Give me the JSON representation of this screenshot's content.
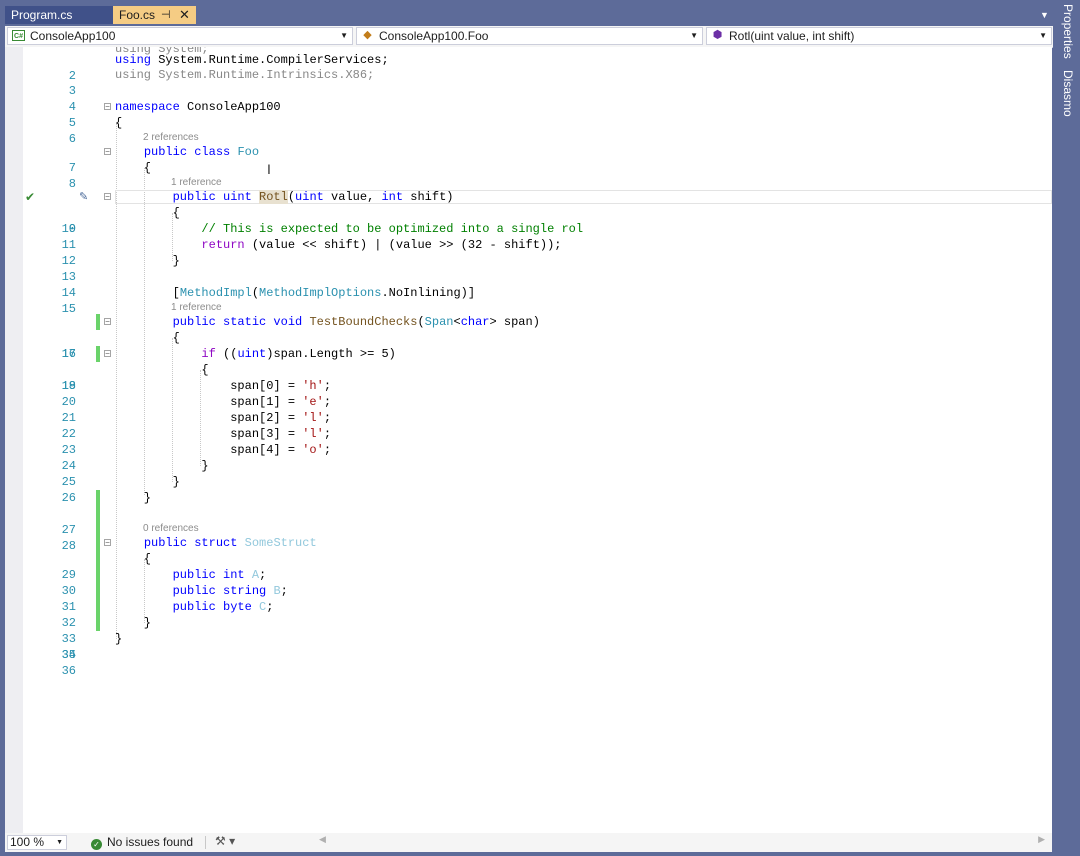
{
  "tabs": [
    {
      "label": "Program.cs",
      "active": false
    },
    {
      "label": "Foo.cs",
      "active": true,
      "pin_glyph": "⊣",
      "close_glyph": "✕"
    }
  ],
  "nav": {
    "project": {
      "icon": "csharp-project-icon",
      "label": "ConsoleApp100"
    },
    "type": {
      "icon": "class-icon",
      "label": "ConsoleApp100.Foo"
    },
    "member": {
      "icon": "method-icon",
      "label": "Rotl(uint value, int shift)"
    }
  },
  "editor": {
    "references": [
      "2 references",
      "1 reference",
      "1 reference",
      "0 references"
    ],
    "lines": [
      {
        "n": "2",
        "t": "using System.Runtime.CompilerServices;"
      },
      {
        "n": "3",
        "t": "using System.Runtime.Intrinsics.X86;"
      },
      {
        "n": "4",
        "t": ""
      },
      {
        "n": "5",
        "t": "namespace ConsoleApp100"
      },
      {
        "n": "6",
        "t": "{"
      },
      {
        "n": "7",
        "t": "    public class Foo"
      },
      {
        "n": "8",
        "t": "    {"
      },
      {
        "n": "9",
        "t": "        public uint Rotl(uint value, int shift)"
      },
      {
        "n": "10",
        "t": "        {"
      },
      {
        "n": "11",
        "t": "            // This is expected to be optimized into a single rol"
      },
      {
        "n": "12",
        "t": "            return (value << shift) | (value >> (32 - shift));"
      },
      {
        "n": "13",
        "t": "        }"
      },
      {
        "n": "14",
        "t": ""
      },
      {
        "n": "15",
        "t": "        [MethodImpl(MethodImplOptions.NoInlining)]"
      },
      {
        "n": "16",
        "t": "        public static void TestBoundChecks(Span<char> span)"
      },
      {
        "n": "17",
        "t": "        {"
      },
      {
        "n": "18",
        "t": "            if ((uint)span.Length >= 5)"
      },
      {
        "n": "19",
        "t": "            {"
      },
      {
        "n": "20",
        "t": "                span[0] = 'h';"
      },
      {
        "n": "21",
        "t": "                span[1] = 'e';"
      },
      {
        "n": "22",
        "t": "                span[2] = 'l';"
      },
      {
        "n": "23",
        "t": "                span[3] = 'l';"
      },
      {
        "n": "24",
        "t": "                span[4] = 'o';"
      },
      {
        "n": "25",
        "t": "            }"
      },
      {
        "n": "26",
        "t": "        }"
      },
      {
        "n": "27",
        "t": "    }"
      },
      {
        "n": "28",
        "t": ""
      },
      {
        "n": "29",
        "t": "    public struct SomeStruct"
      },
      {
        "n": "30",
        "t": "    {"
      },
      {
        "n": "31",
        "t": "        public int A;"
      },
      {
        "n": "32",
        "t": "        public string B;"
      },
      {
        "n": "33",
        "t": "        public byte C;"
      },
      {
        "n": "34",
        "t": "    }"
      },
      {
        "n": "35",
        "t": "}"
      },
      {
        "n": "36",
        "t": ""
      }
    ]
  },
  "status": {
    "zoom": "100 %",
    "issues": "No issues found",
    "issues_icon": "check-circle-icon"
  },
  "side_tabs": [
    "Properties",
    "Disasmo"
  ],
  "colors": {
    "chrome": "#5d6b99",
    "active_tab": "#f5cc84",
    "inactive_tab": "#405189",
    "keyword": "#0000ff",
    "type": "#2b91af",
    "comment": "#008000",
    "string": "#a31515",
    "change_marker": "#6ad36a"
  }
}
